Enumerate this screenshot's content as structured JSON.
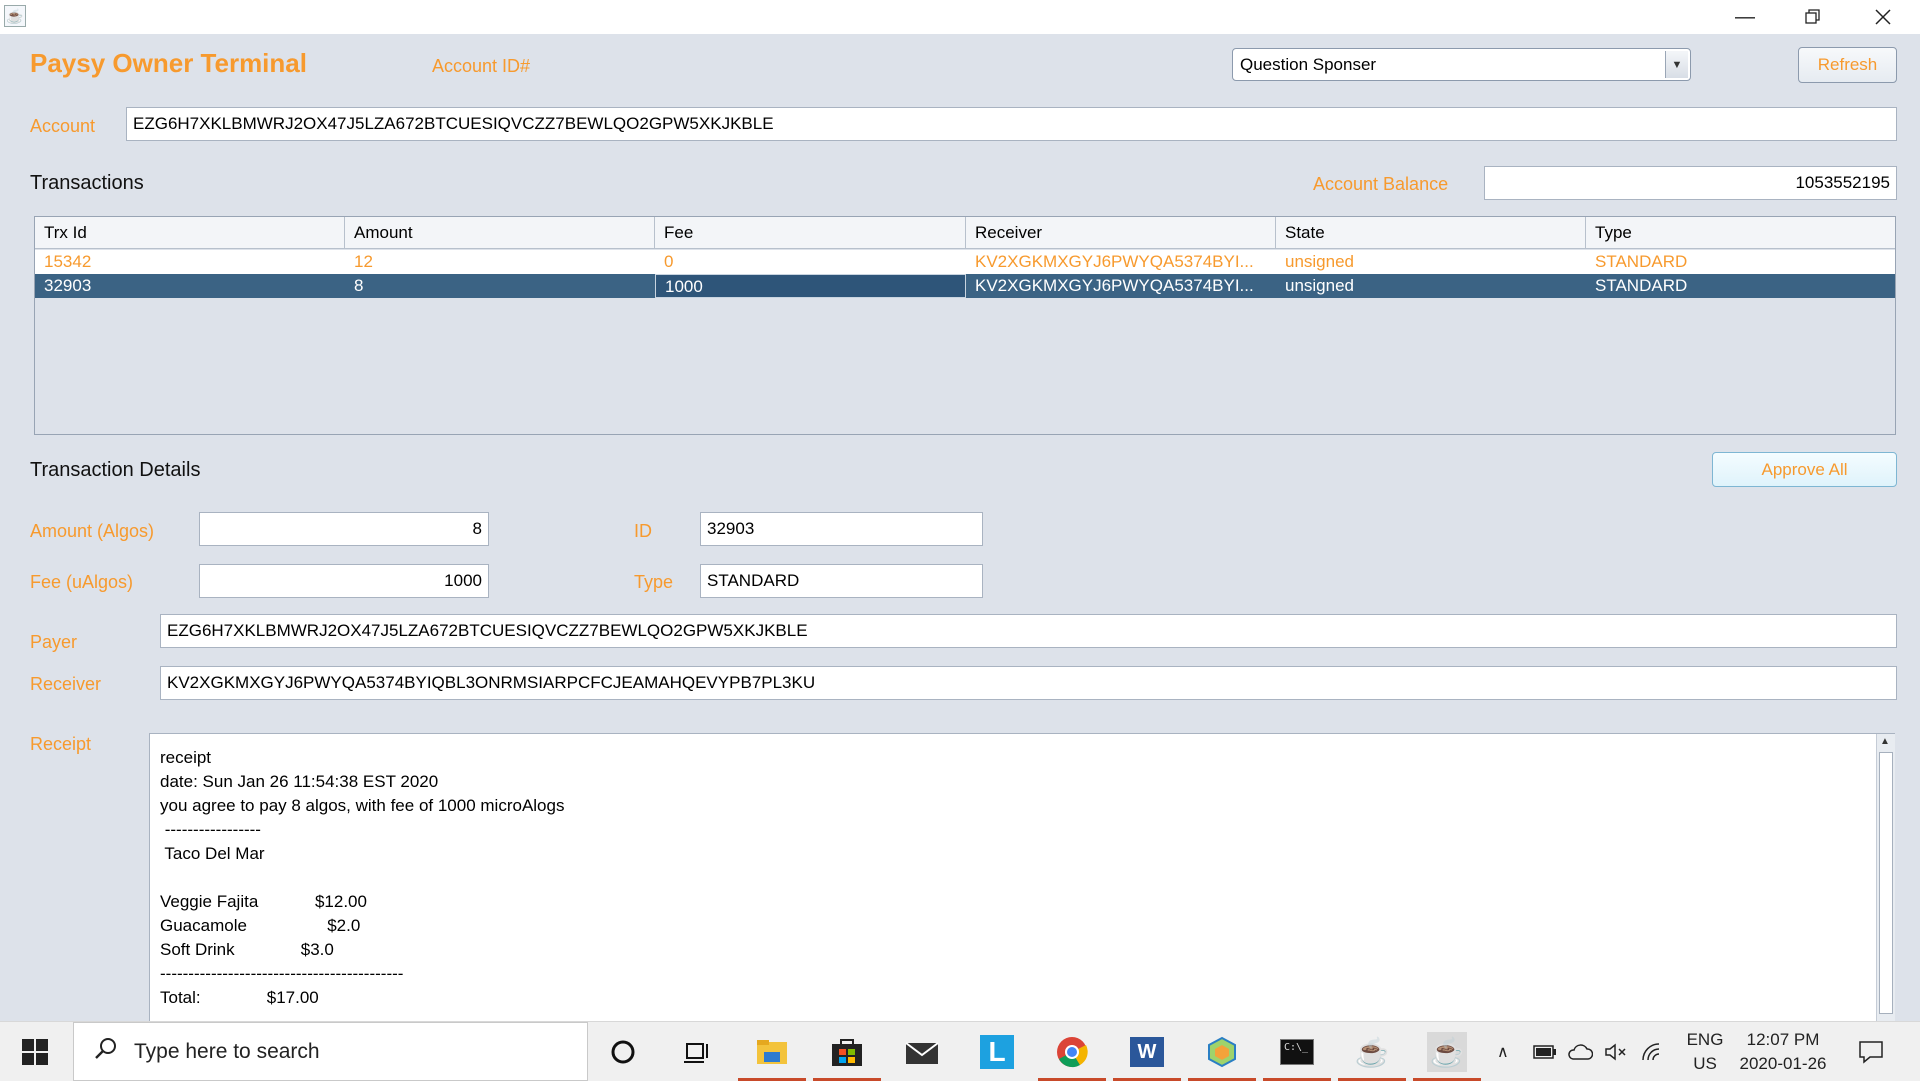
{
  "window": {
    "minimize_icon": "minimize-icon",
    "restore_icon": "restore-icon",
    "close_icon": "close-icon"
  },
  "header": {
    "title": "Paysy Owner Terminal",
    "account_id_label": "Account ID#",
    "account_select_value": "Question Sponser",
    "refresh_label": "Refresh"
  },
  "account": {
    "label": "Account",
    "value": "EZG6H7XKLBMWRJ2OX47J5LZA672BTCUESIQVCZZ7BEWLQO2GPW5XKJKBLE"
  },
  "transactions": {
    "heading": "Transactions",
    "balance_label": "Account Balance",
    "balance_value": "1053552195",
    "columns": [
      "Trx Id",
      "Amount",
      "Fee",
      "Receiver",
      "State",
      "Type"
    ],
    "rows": [
      [
        "15342",
        "12",
        "0",
        "KV2XGKMXGYJ6PWYQA5374BYI...",
        "unsigned",
        "STANDARD"
      ],
      [
        "32903",
        "8",
        "1000",
        "KV2XGKMXGYJ6PWYQA5374BYI...",
        "unsigned",
        "STANDARD"
      ]
    ],
    "selected_row": 1
  },
  "details": {
    "heading": "Transaction Details",
    "approve_all_label": "Approve All",
    "amount_label": "Amount (Algos)",
    "amount_value": "8",
    "fee_label": "Fee (uAlgos)",
    "fee_value": "1000",
    "id_label": "ID",
    "id_value": "32903",
    "type_label": "Type",
    "type_value": "STANDARD",
    "payer_label": "Payer",
    "payer_value": "EZG6H7XKLBMWRJ2OX47J5LZA672BTCUESIQVCZZ7BEWLQO2GPW5XKJKBLE",
    "receiver_label": "Receiver",
    "receiver_value": "KV2XGKMXGYJ6PWYQA5374BYIQBL3ONRMSIARPCFCJEAMAHQEVYPB7PL3KU",
    "receipt_label": "Receipt",
    "receipt_text": "receipt\ndate: Sun Jan 26 11:54:38 EST 2020\nyou agree to pay 8 algos, with fee of 1000 microAlogs\n -----------------\n Taco Del Mar\n\nVeggie Fajita            $12.00\nGuacamole                 $2.0\nSoft Drink              $3.0\n-------------------------------------------\nTotal:              $17.00"
  },
  "taskbar": {
    "search_placeholder": "Type here to search",
    "lang_top": "ENG",
    "lang_bottom": "US",
    "time": "12:07 PM",
    "date": "2020-01-26"
  }
}
